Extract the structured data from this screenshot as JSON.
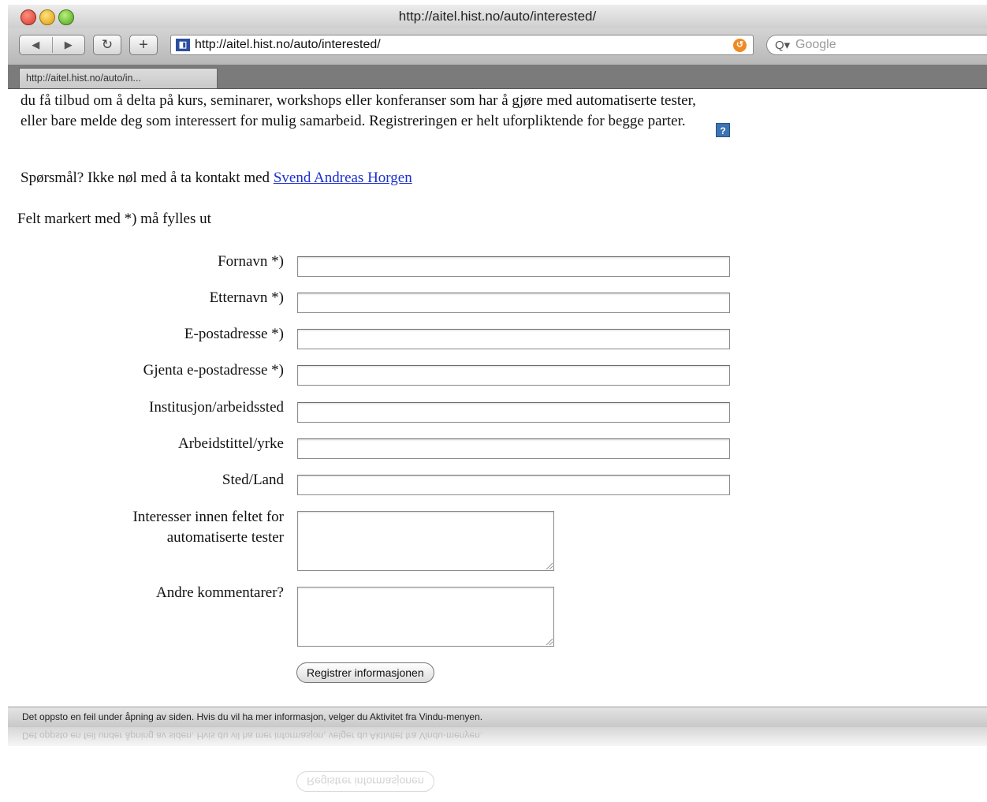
{
  "window": {
    "title": "http://aitel.hist.no/auto/interested/"
  },
  "toolbar": {
    "back_icon": "◀",
    "forward_icon": "▶",
    "reload_icon": "↻",
    "add_icon": "+",
    "url": "http://aitel.hist.no/auto/interested/",
    "search_placeholder": "Google",
    "search_icon": "Q▾"
  },
  "tab": {
    "label": "http://aitel.hist.no/auto/in..."
  },
  "page": {
    "intro": "du få tilbud om å delta på kurs, seminarer, workshops eller konferanser som har å gjøre med automatiserte tester, eller bare melde deg som interessert for mulig samarbeid. Registreringen er helt uforpliktende for begge parter.",
    "help_icon": "?",
    "contact_prefix": "Spørsmål? Ikke nøl med å ta kontakt med",
    "contact_link": "Svend Andreas Horgen",
    "required_note": "Felt markert med *) må fylles ut",
    "fields": {
      "firstname": "Fornavn *)",
      "lastname": "Etternavn *)",
      "email": "E-postadresse *)",
      "email_repeat": "Gjenta e-postadresse *)",
      "institution": "Institusjon/arbeidssted",
      "jobtitle": "Arbeidstittel/yrke",
      "place": "Sted/Land",
      "interests_line1": "Interesser innen feltet for",
      "interests_line2": "automatiserte tester",
      "comments": "Andre kommentarer?"
    },
    "submit_label": "Registrer informasjonen"
  },
  "status": {
    "message": "Det oppsto en feil under åpning av siden. Hvis du vil ha mer informasjon, velger du Aktivitet fra Vindu-menyen."
  }
}
